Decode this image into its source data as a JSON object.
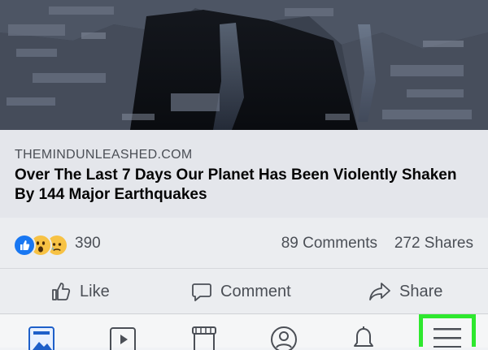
{
  "hero_image": {
    "icon": "earthquake-photo"
  },
  "link": {
    "domain": "THEMINDUNLEASHED.COM",
    "headline": "Over The Last 7 Days Our Planet Has Been Violently Shaken By 144 Major Earthquakes"
  },
  "stats": {
    "reactions": [
      "like",
      "wow",
      "sad"
    ],
    "reaction_count": "390",
    "comments": "89 Comments",
    "shares": "272 Shares"
  },
  "actions": {
    "like": "Like",
    "comment": "Comment",
    "share": "Share"
  },
  "tabbar": {
    "items": [
      "news-feed-icon",
      "watch-icon",
      "marketplace-icon",
      "profile-icon",
      "notifications-icon",
      "menu-icon"
    ],
    "highlight_color": "#2ee82e"
  },
  "colors": {
    "like_blue": "#1877f2",
    "wow_yellow": "#f7c244"
  }
}
